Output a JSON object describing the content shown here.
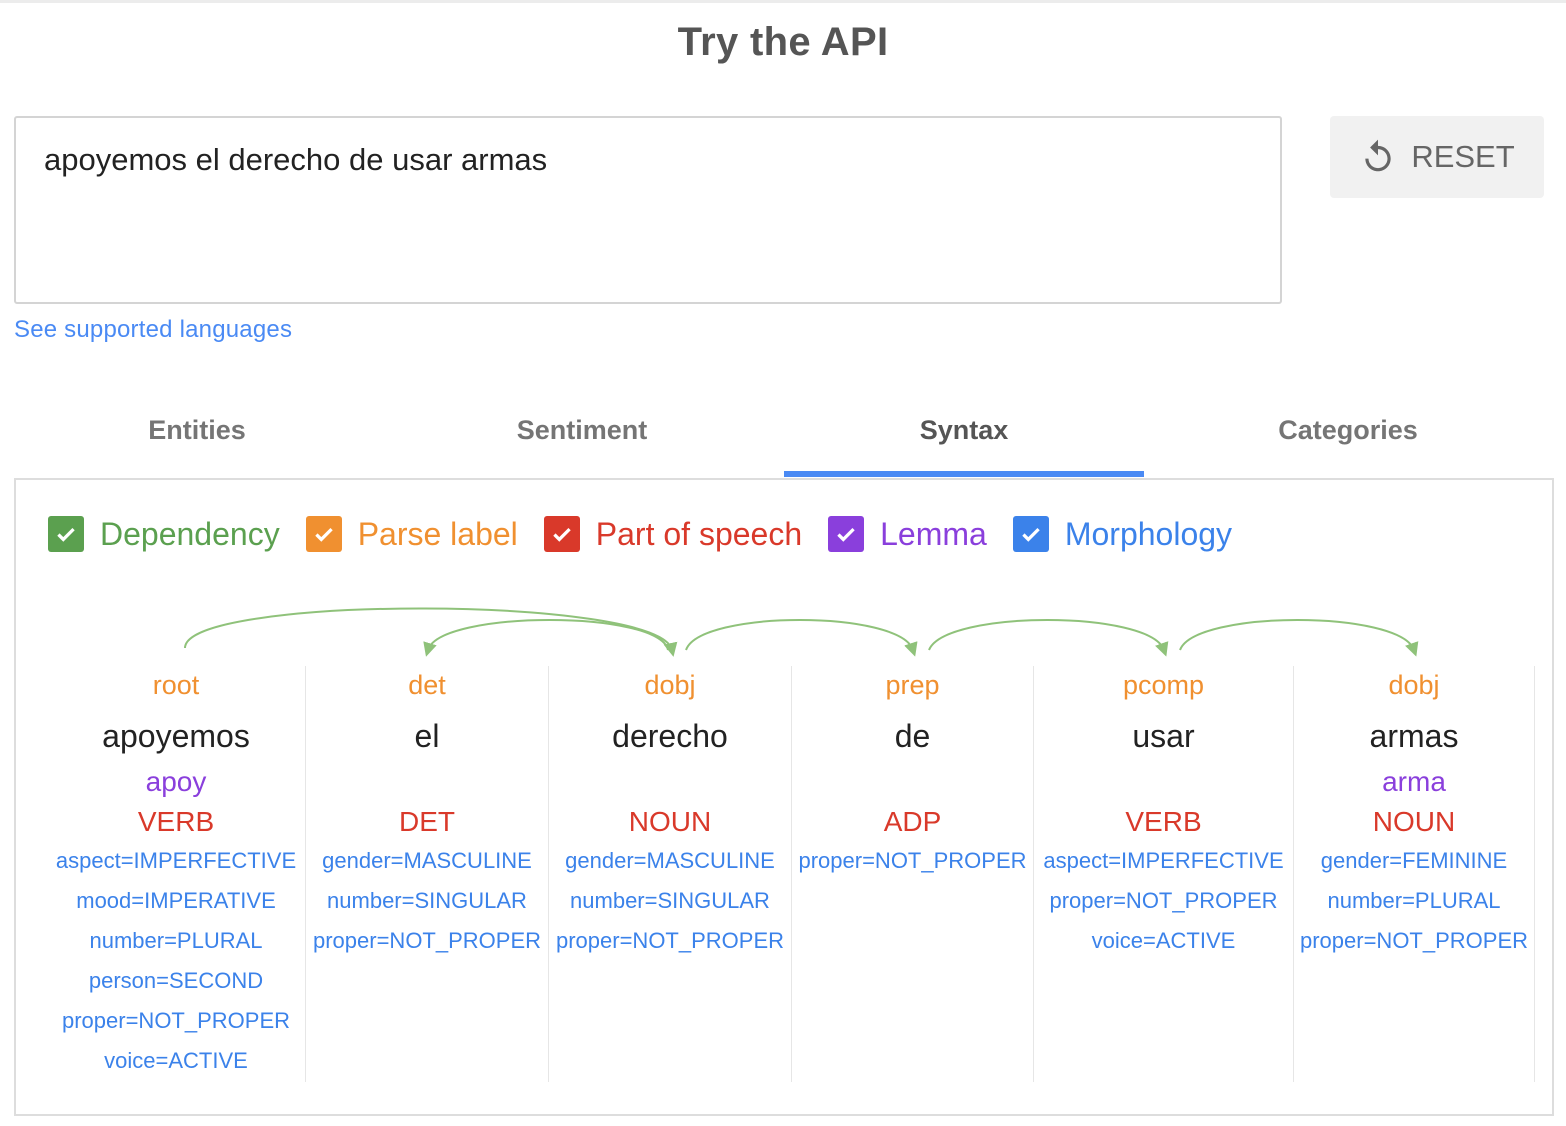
{
  "header": {
    "title": "Try the API"
  },
  "input": {
    "text": "apoyemos el derecho de usar armas"
  },
  "reset": {
    "label": "RESET",
    "icon": "reset-icon"
  },
  "languages_link": "See supported languages",
  "tabs": [
    {
      "label": "Entities",
      "active": false
    },
    {
      "label": "Sentiment",
      "active": false
    },
    {
      "label": "Syntax",
      "active": true
    },
    {
      "label": "Categories",
      "active": false
    }
  ],
  "legend": [
    {
      "label": "Dependency",
      "color": "#5ba04f",
      "checked": true
    },
    {
      "label": "Parse label",
      "color": "#f09030",
      "checked": true
    },
    {
      "label": "Part of speech",
      "color": "#d9392a",
      "checked": true
    },
    {
      "label": "Lemma",
      "color": "#8a3fdc",
      "checked": true
    },
    {
      "label": "Morphology",
      "color": "#3b82ea",
      "checked": true
    }
  ],
  "colors": {
    "accent": "#4a8af4",
    "dependency_arc": "#8fc27a"
  },
  "tokens": [
    {
      "label": "root",
      "word": "apoyemos",
      "lemma": "apoy",
      "pos": "VERB",
      "morphology": [
        "aspect=IMPERFECTIVE",
        "mood=IMPERATIVE",
        "number=PLURAL",
        "person=SECOND",
        "proper=NOT_PROPER",
        "voice=ACTIVE"
      ]
    },
    {
      "label": "det",
      "word": "el",
      "lemma": "",
      "pos": "DET",
      "morphology": [
        "gender=MASCULINE",
        "number=SINGULAR",
        "proper=NOT_PROPER"
      ]
    },
    {
      "label": "dobj",
      "word": "derecho",
      "lemma": "",
      "pos": "NOUN",
      "morphology": [
        "gender=MASCULINE",
        "number=SINGULAR",
        "proper=NOT_PROPER"
      ]
    },
    {
      "label": "prep",
      "word": "de",
      "lemma": "",
      "pos": "ADP",
      "morphology": [
        "proper=NOT_PROPER"
      ]
    },
    {
      "label": "pcomp",
      "word": "usar",
      "lemma": "",
      "pos": "VERB",
      "morphology": [
        "aspect=IMPERFECTIVE",
        "proper=NOT_PROPER",
        "voice=ACTIVE"
      ]
    },
    {
      "label": "dobj",
      "word": "armas",
      "lemma": "arma",
      "pos": "NOUN",
      "morphology": [
        "gender=FEMININE",
        "number=PLURAL",
        "proper=NOT_PROPER"
      ]
    }
  ],
  "dependencies": [
    {
      "from": 0,
      "to": 2
    },
    {
      "from": 2,
      "to": 1
    },
    {
      "from": 2,
      "to": 3
    },
    {
      "from": 3,
      "to": 4
    },
    {
      "from": 4,
      "to": 5
    }
  ]
}
